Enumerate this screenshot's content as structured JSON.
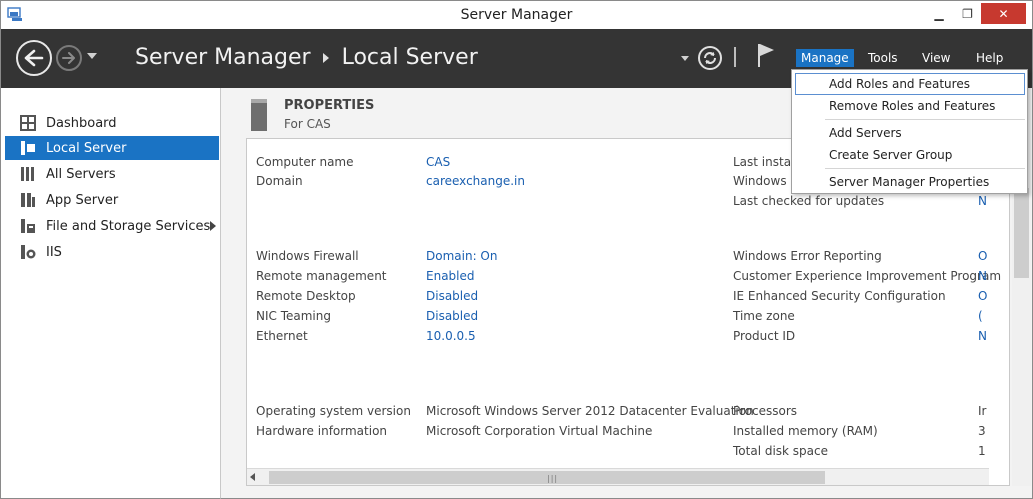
{
  "window": {
    "title": "Server Manager",
    "close_glyph": "✕",
    "min_glyph": "▁",
    "max_glyph": "❐"
  },
  "header": {
    "breadcrumb_root": "Server Manager",
    "breadcrumb_current": "Local Server",
    "menus": {
      "manage": "Manage",
      "tools": "Tools",
      "view": "View",
      "help": "Help"
    },
    "accent_color": "#1a73c4"
  },
  "sidebar": {
    "items": [
      {
        "label": "Dashboard",
        "icon": "dashboard-icon"
      },
      {
        "label": "Local Server",
        "icon": "local-server-icon"
      },
      {
        "label": "All Servers",
        "icon": "all-servers-icon"
      },
      {
        "label": "App Server",
        "icon": "app-server-icon"
      },
      {
        "label": "File and Storage Services",
        "icon": "storage-icon"
      },
      {
        "label": "IIS",
        "icon": "iis-icon"
      }
    ]
  },
  "properties": {
    "title": "PROPERTIES",
    "subtitle": "For CAS",
    "left": [
      {
        "label": "Computer name",
        "value": "CAS"
      },
      {
        "label": "Domain",
        "value": "careexchange.in"
      },
      {
        "label": "Windows Firewall",
        "value": "Domain: On"
      },
      {
        "label": "Remote management",
        "value": "Enabled"
      },
      {
        "label": "Remote Desktop",
        "value": "Disabled"
      },
      {
        "label": "NIC Teaming",
        "value": "Disabled"
      },
      {
        "label": "Ethernet",
        "value": "10.0.0.5"
      },
      {
        "label": "Operating system version",
        "value": "Microsoft Windows Server 2012 Datacenter Evaluation"
      },
      {
        "label": "Hardware information",
        "value": "Microsoft Corporation Virtual Machine"
      }
    ],
    "right": [
      {
        "label": "Last installe",
        "value": ""
      },
      {
        "label": "Windows U",
        "value": ""
      },
      {
        "label": "Last checked for updates",
        "value": "N"
      },
      {
        "label": "Windows Error Reporting",
        "value": "O"
      },
      {
        "label": "Customer Experience Improvement Program",
        "value": "N"
      },
      {
        "label": "IE Enhanced Security Configuration",
        "value": "O"
      },
      {
        "label": "Time zone",
        "value": "("
      },
      {
        "label": "Product ID",
        "value": "N"
      },
      {
        "label": "Processors",
        "value": "Ir"
      },
      {
        "label": "Installed memory (RAM)",
        "value": "3"
      },
      {
        "label": "Total disk space",
        "value": "1"
      }
    ]
  },
  "manage_menu": {
    "items": [
      "Add Roles and Features",
      "Remove Roles and Features",
      "Add Servers",
      "Create Server Group",
      "Server Manager Properties"
    ]
  }
}
